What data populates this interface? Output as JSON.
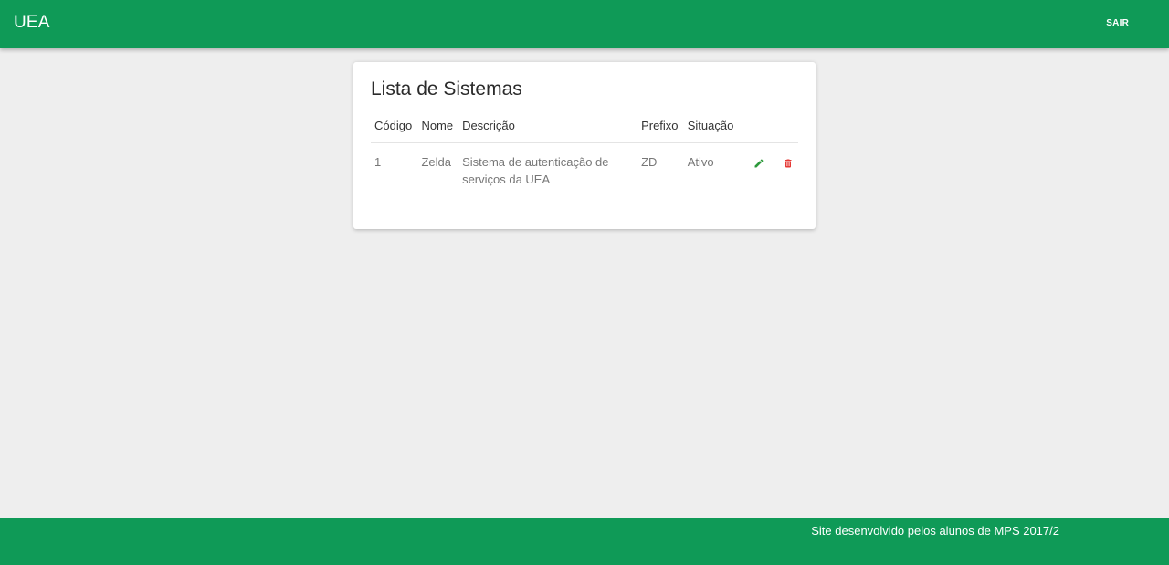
{
  "header": {
    "brand": "UEA",
    "logout_label": "SAIR"
  },
  "card": {
    "title": "Lista de Sistemas",
    "columns": [
      "Código",
      "Nome",
      "Descrição",
      "Prefixo",
      "Situação"
    ],
    "rows": [
      {
        "codigo": "1",
        "nome": "Zelda",
        "descricao": "Sistema de autenticação de serviços da UEA",
        "prefixo": "ZD",
        "situacao": "Ativo",
        "edit_icon": "pencil-icon",
        "delete_icon": "trash-icon"
      }
    ]
  },
  "footer": {
    "text": "Site desenvolvido pelos alunos de MPS 2017/2"
  },
  "colors": {
    "primary": "#0f9a57",
    "background": "#eeeeee",
    "edit": "#2e9a3c",
    "delete": "#e53935"
  }
}
